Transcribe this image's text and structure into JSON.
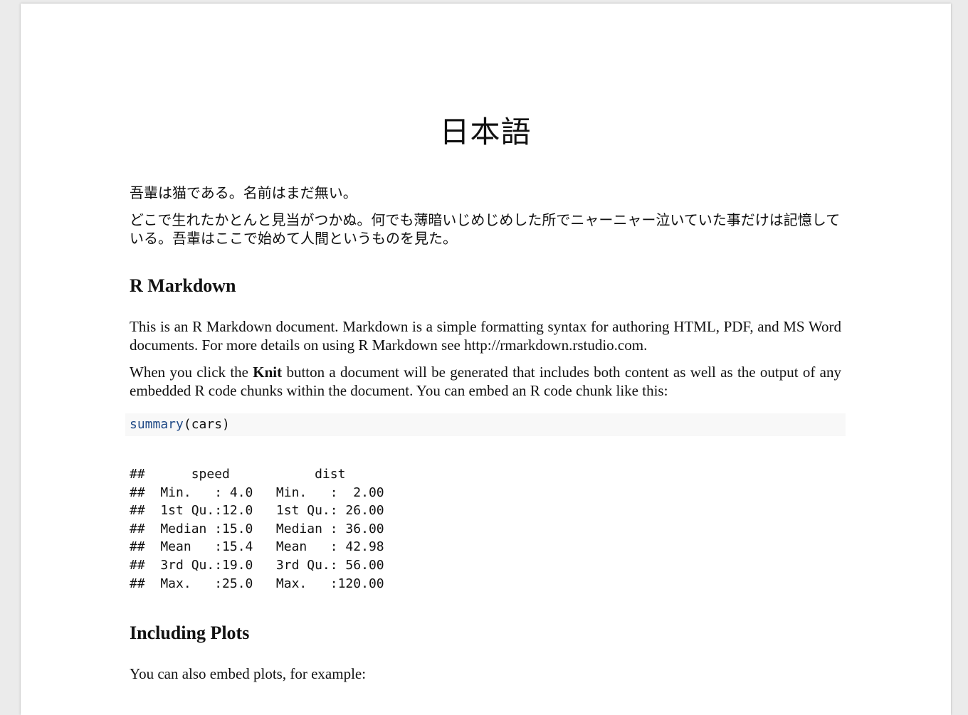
{
  "document": {
    "title": "日本語",
    "jp_paragraph_1": "吾輩は猫である。名前はまだ無い。",
    "jp_paragraph_2": "どこで生れたかとんと見当がつかぬ。何でも薄暗いじめじめした所でニャーニャー泣いていた事だけは記憶している。吾輩はここで始めて人間というものを見た。",
    "section_1_heading": "R Markdown",
    "section_1_para_1": "This is an R Markdown document. Markdown is a simple formatting syntax for authoring HTML, PDF, and MS Word documents. For more details on using R Markdown see http://rmarkdown.rstudio.com.",
    "section_1_para_2_before": "When you click the ",
    "section_1_para_2_bold": "Knit",
    "section_1_para_2_after": " button a document will be generated that includes both content as well as the output of any embedded R code chunks within the document. You can embed an R code chunk like this:",
    "code_function": "summary",
    "code_args": "(cars)",
    "output_lines": [
      "##      speed           dist       ",
      "##  Min.   : 4.0   Min.   :  2.00  ",
      "##  1st Qu.:12.0   1st Qu.: 26.00  ",
      "##  Median :15.0   Median : 36.00  ",
      "##  Mean   :15.4   Mean   : 42.98  ",
      "##  3rd Qu.:19.0   3rd Qu.: 56.00  ",
      "##  Max.   :25.0   Max.   :120.00  "
    ],
    "section_2_heading": "Including Plots",
    "section_2_para_1": "You can also embed plots, for example:"
  },
  "colors": {
    "code_background": "#f8f8f8",
    "code_function": "#204a87",
    "viewer_background": "#ebebeb"
  }
}
